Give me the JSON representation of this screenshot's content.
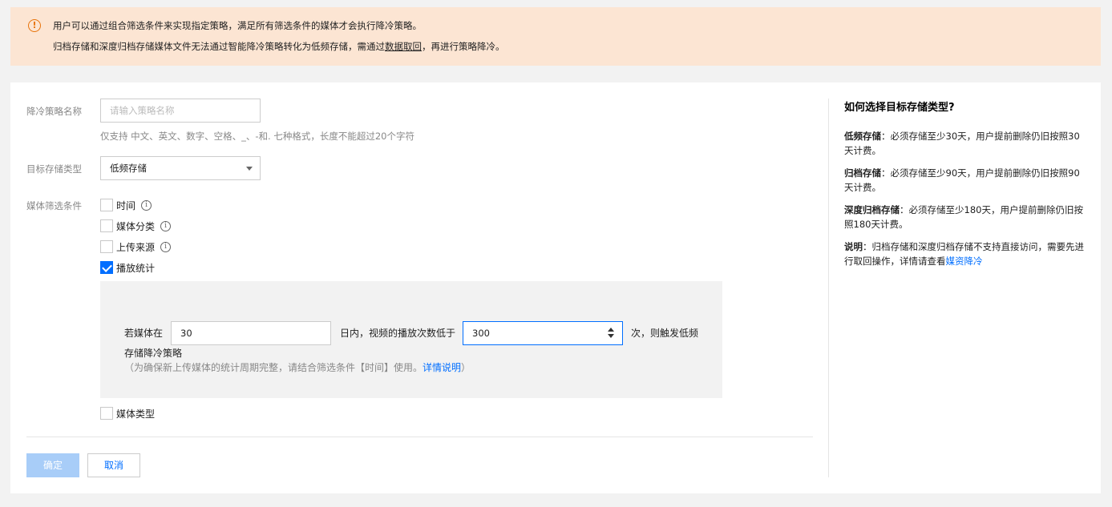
{
  "notice": {
    "icon": "warning-circle-icon",
    "line1": "用户可以通过组合筛选条件来实现指定策略，满足所有筛选条件的媒体才会执行降冷策略。",
    "line2_before": "归档存储和深度归档存储媒体文件无法通过智能降冷策略转化为低频存储，需通过",
    "line2_link": "数据取回",
    "line2_after": "，再进行策略降冷。"
  },
  "form": {
    "name_label": "降冷策略名称",
    "name_placeholder": "请输入策略名称",
    "name_hint": "仅支持 中文、英文、数字、空格、_、-和. 七种格式，长度不能超过20个字符",
    "storage_label": "目标存储类型",
    "storage_value": "低频存储",
    "filter_label": "媒体筛选条件",
    "filters": [
      {
        "label": "时间",
        "checked": false,
        "info": true
      },
      {
        "label": "媒体分类",
        "checked": false,
        "info": true
      },
      {
        "label": "上传来源",
        "checked": false,
        "info": true
      },
      {
        "label": "播放统计",
        "checked": true,
        "info": false
      }
    ],
    "play_stats": {
      "prefix": "若媒体在",
      "days_value": "30",
      "middle": "日内，视频的播放次数低于",
      "count_value": "300",
      "suffix_line1": "次，则触发低频",
      "suffix_line2": "存储降冷策略",
      "note_before": "（为确保新上传媒体的统计周期完整，请结合筛选条件【时间】使用。",
      "note_link": "详情说明",
      "note_after": "）"
    },
    "media_type_label": "媒体类型",
    "confirm_label": "确定",
    "cancel_label": "取消"
  },
  "side": {
    "title": "如何选择目标存储类型?",
    "items": [
      {
        "term": "低频存储",
        "text": "：必须存储至少30天，用户提前删除仍旧按照30天计费。"
      },
      {
        "term": "归档存储",
        "text": "：必须存储至少90天，用户提前删除仍旧按照90天计费。"
      },
      {
        "term": "深度归档存储",
        "text": "：必须存储至少180天，用户提前删除仍旧按照180天计费。"
      }
    ],
    "note_term": "说明",
    "note_text": "：归档存储和深度归档存储不支持直接访问，需要先进行取回操作，详情请查看",
    "note_link": "媒资降冷"
  },
  "colors": {
    "accent": "#006eff",
    "warning": "#e8740c",
    "notice_bg": "#fce5d3"
  }
}
